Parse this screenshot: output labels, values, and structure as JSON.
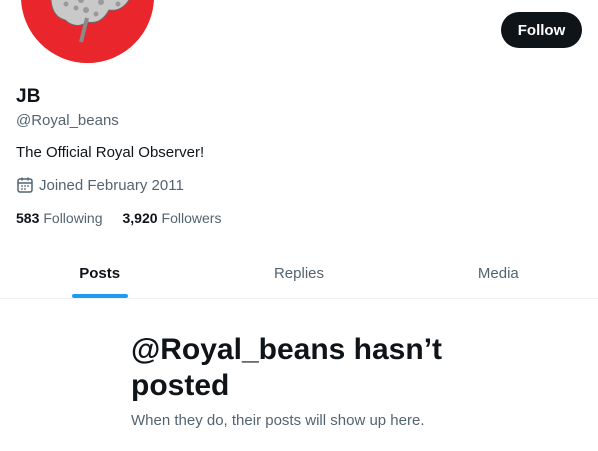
{
  "profile": {
    "display_name": "JB",
    "handle": "@Royal_beans",
    "bio": "The Official Royal Observer!",
    "joined": "Joined February 2011",
    "avatar_bg_color": "#e8262b"
  },
  "actions": {
    "follow_label": "Follow"
  },
  "stats": [
    {
      "value": "583",
      "label": "Following"
    },
    {
      "value": "3,920",
      "label": "Followers"
    }
  ],
  "tabs": [
    {
      "label": "Posts",
      "active": true
    },
    {
      "label": "Replies",
      "active": false
    },
    {
      "label": "Media",
      "active": false
    }
  ],
  "empty_state": {
    "title": "@Royal_beans hasn’t posted",
    "subtitle": "When they do, their posts will show up here."
  },
  "colors": {
    "accent": "#1d9bf0",
    "text_primary": "#0f1419",
    "text_secondary": "#536471"
  },
  "icons": {
    "joined": "calendar-icon"
  }
}
